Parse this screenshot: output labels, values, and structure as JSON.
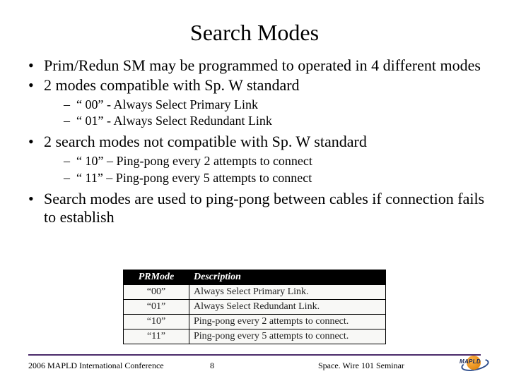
{
  "title": "Search Modes",
  "bullets": {
    "b1": "Prim/Redun SM may be programmed to operated in 4 different modes",
    "b2": "2 modes compatible with Sp. W standard",
    "b2a": "“ 00” - Always Select Primary Link",
    "b2b": "“ 01” - Always Select Redundant Link",
    "b3": "2 search modes not compatible with Sp. W standard",
    "b3a": "“ 10” – Ping-pong every 2 attempts to connect",
    "b3b": "“ 11” – Ping-pong every 5 attempts to connect",
    "b4": "Search modes are used to ping-pong between cables if connection fails to establish"
  },
  "table": {
    "headers": {
      "c1": "PRMode",
      "c2": "Description"
    },
    "rows": [
      {
        "mode": "“00”",
        "desc": "Always Select Primary Link."
      },
      {
        "mode": "“01”",
        "desc": "Always Select Redundant Link."
      },
      {
        "mode": "“10”",
        "desc": "Ping-pong every 2 attempts to connect."
      },
      {
        "mode": "“11”",
        "desc": "Ping-pong every 5 attempts to connect."
      }
    ]
  },
  "footer": {
    "left": "2006 MAPLD International Conference",
    "center": "8",
    "right": "Space. Wire 101 Seminar",
    "logo_text": "MAPLD"
  },
  "chart_data": {
    "type": "table",
    "title": "PRMode search modes",
    "columns": [
      "PRMode",
      "Description"
    ],
    "rows": [
      [
        "00",
        "Always Select Primary Link."
      ],
      [
        "01",
        "Always Select Redundant Link."
      ],
      [
        "10",
        "Ping-pong every 2 attempts to connect."
      ],
      [
        "11",
        "Ping-pong every 5 attempts to connect."
      ]
    ]
  }
}
